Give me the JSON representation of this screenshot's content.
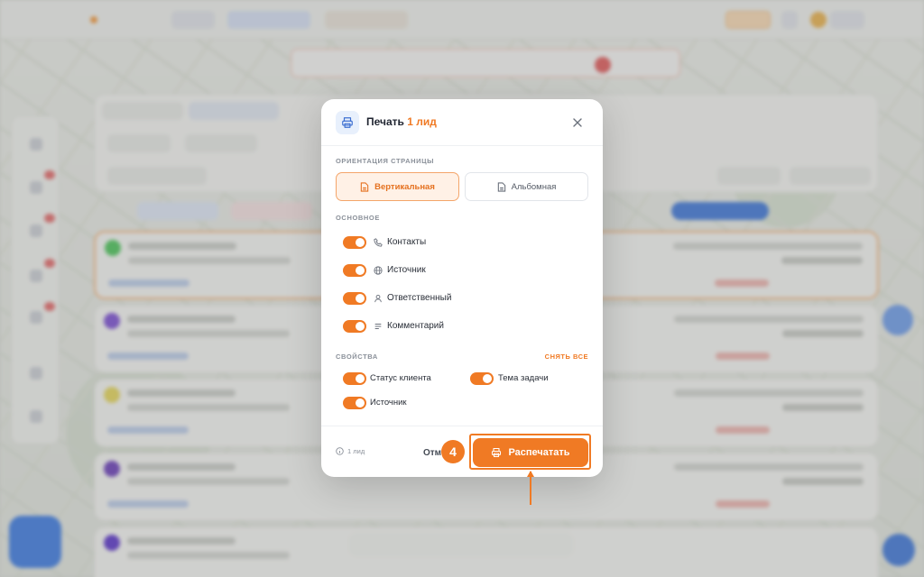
{
  "modal": {
    "title": "Печать",
    "title_count": "1 лид",
    "orientation_label": "Ориентация страницы",
    "orientation_options": [
      {
        "label": "Вертикальная",
        "selected": true,
        "icon": "portrait-page-icon"
      },
      {
        "label": "Альбомная",
        "selected": false,
        "icon": "landscape-page-icon"
      }
    ],
    "basic_label": "Основное",
    "basic_options": [
      {
        "label": "Контакты",
        "enabled": true,
        "icon": "phone-icon"
      },
      {
        "label": "Источник",
        "enabled": true,
        "icon": "globe-icon"
      },
      {
        "label": "Ответственный",
        "enabled": true,
        "icon": "user-icon"
      },
      {
        "label": "Комментарий",
        "enabled": true,
        "icon": "lines-icon"
      }
    ],
    "properties_label": "Свойства",
    "clear_all_label": "Снять все",
    "properties_options": [
      {
        "label": "Статус клиента",
        "enabled": true
      },
      {
        "label": "Тема задачи",
        "enabled": true
      },
      {
        "label": "Источник",
        "enabled": true
      }
    ],
    "footer_count": "1 лид",
    "cancel_label": "Отм",
    "print_label": "Распечатать"
  },
  "annotation": {
    "step_number": "4"
  },
  "colors": {
    "accent": "#f07a24",
    "accent_light": "#fff1e6",
    "icon_blue": "#3d6fd1"
  }
}
